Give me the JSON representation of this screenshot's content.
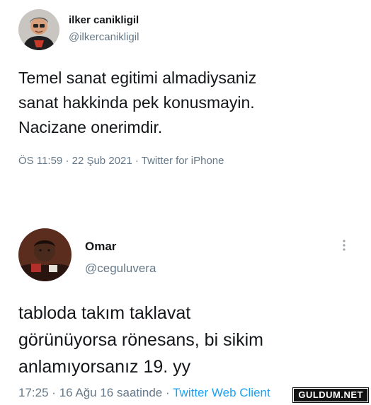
{
  "tweets": [
    {
      "name": "ilker canikligil",
      "handle": "@ilkercanikligil",
      "text": "Temel sanat egitimi almadiysaniz\nsanat hakkinda pek konusmayin.\nNacizane onerimdir.",
      "time": "ÖS 11:59",
      "sep1": "·",
      "date": "22 Şub 2021",
      "sep2": "·",
      "source": "Twitter for iPhone"
    },
    {
      "name": "Omar",
      "handle": "@ceguluvera",
      "text": "tabloda takım taklavat\ngörünüyorsa rönesans, bi sikim\nanlamıyorsanız 19. yy",
      "time": "17:25",
      "sep1": "·",
      "date": "16 Ağu 16 saatinde",
      "sep2": "·",
      "source": "Twitter Web Client"
    }
  ],
  "watermark": "GULDUM.NET",
  "icons": {
    "more": "more-vertical-icon",
    "avatar1": "avatar",
    "avatar2": "avatar"
  },
  "colors": {
    "text": "#14171a",
    "muted": "#657786",
    "link": "#1da1f2"
  }
}
